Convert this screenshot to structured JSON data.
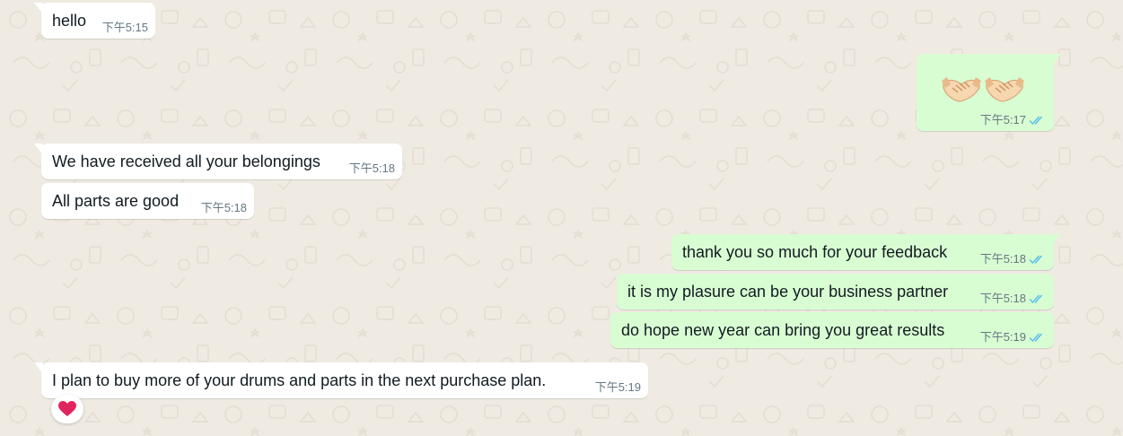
{
  "messages": [
    {
      "direction": "in",
      "text": "hello",
      "time": "下午5:15"
    },
    {
      "direction": "out",
      "emoji": [
        "handshake-icon",
        "handshake-icon"
      ],
      "time": "下午5:17",
      "status": "read"
    },
    {
      "direction": "in",
      "text": "We have received all your belongings",
      "time": "下午5:18"
    },
    {
      "direction": "in",
      "text": "All parts are good",
      "time": "下午5:18"
    },
    {
      "direction": "out",
      "text": "thank you so much for your feedback",
      "time": "下午5:18",
      "status": "read"
    },
    {
      "direction": "out",
      "text": "it is my plasure can be your business partner",
      "time": "下午5:18",
      "status": "read"
    },
    {
      "direction": "out",
      "text": "do hope new year can bring you great results",
      "time": "下午5:19",
      "status": "read"
    },
    {
      "direction": "in",
      "text": "I plan to buy more of your drums and parts in the next purchase plan.",
      "time": "下午5:19",
      "reaction": "red-heart-icon"
    }
  ],
  "colors": {
    "background": "#efeae2",
    "incoming_bubble": "#ffffff",
    "outgoing_bubble": "#d9fdd3",
    "text": "#111b21",
    "meta_text": "#667781",
    "read_ticks": "#53bdeb",
    "heart": "#e0245e"
  }
}
